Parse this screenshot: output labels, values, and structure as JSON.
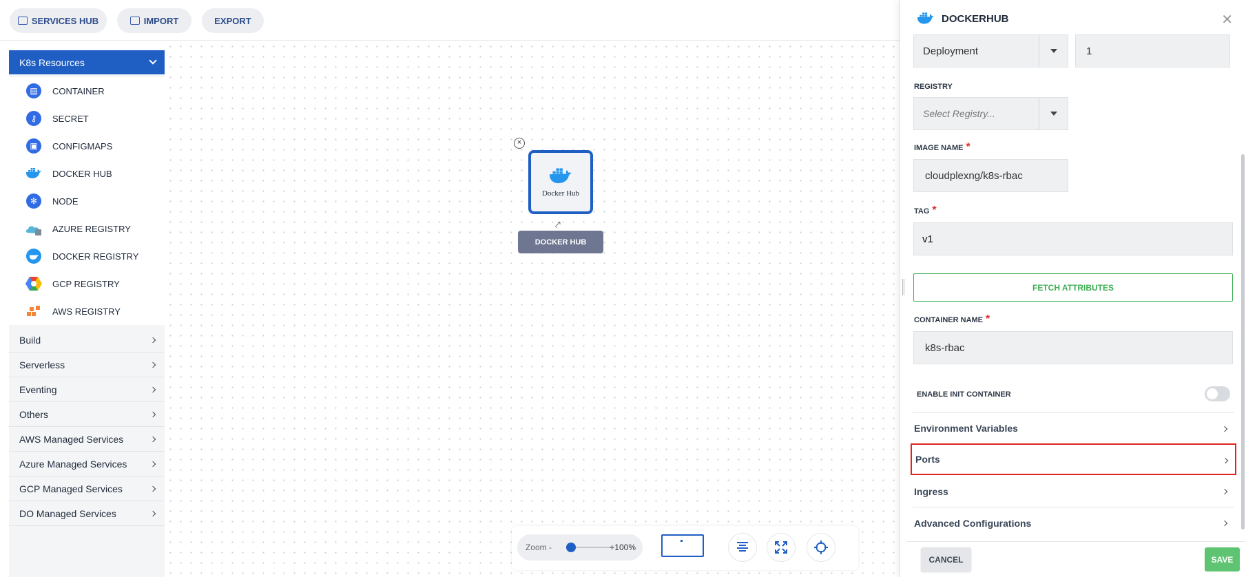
{
  "toolbar": {
    "services_hub": "SERVICES HUB",
    "import": "IMPORT",
    "export": "EXPORT"
  },
  "sidebar": {
    "k8s_header": "K8s Resources",
    "resources": [
      {
        "label": "CONTAINER",
        "icon": "container-icon"
      },
      {
        "label": "SECRET",
        "icon": "secret-icon"
      },
      {
        "label": "CONFIGMAPS",
        "icon": "configmaps-icon"
      },
      {
        "label": "DOCKER HUB",
        "icon": "docker-whale-icon"
      },
      {
        "label": "NODE",
        "icon": "node-icon"
      },
      {
        "label": "AZURE REGISTRY",
        "icon": "azure-registry-icon"
      },
      {
        "label": "DOCKER REGISTRY",
        "icon": "docker-registry-icon"
      },
      {
        "label": "GCP REGISTRY",
        "icon": "gcp-registry-icon"
      },
      {
        "label": "AWS REGISTRY",
        "icon": "aws-registry-icon"
      }
    ],
    "categories": [
      "Build",
      "Serverless",
      "Eventing",
      "Others",
      "AWS Managed Services",
      "Azure Managed Services",
      "GCP Managed Services",
      "DO Managed Services"
    ]
  },
  "canvas": {
    "node_label": "Docker Hub",
    "node_tag": "DOCKER HUB",
    "close_glyph": "×",
    "link_glyph": "⤤"
  },
  "zoom": {
    "label": "Zoom -",
    "value": "+100%",
    "level": 1.0
  },
  "panel": {
    "title": "DOCKERHUB",
    "close_glyph": "✕",
    "kind_select": "Deployment",
    "replicas": "1",
    "registry_label": "REGISTRY",
    "registry_placeholder": "Select Registry...",
    "image_name_label": "IMAGE NAME",
    "image_name_value": "cloudplexng/k8s-rbac",
    "tag_label": "TAG",
    "tag_value": "v1",
    "required_marker": "*",
    "fetch_button": "FETCH ATTRIBUTES",
    "container_name_label": "CONTAINER NAME",
    "container_name_value": "k8s-rbac",
    "init_container_label": "ENABLE INIT CONTAINER",
    "init_container_enabled": false,
    "sections": [
      "Environment Variables",
      "Ports",
      "Ingress",
      "Advanced Configurations"
    ],
    "highlighted_section": "Ports",
    "cancel_button": "CANCEL",
    "save_button": "SAVE"
  },
  "colors": {
    "primary": "#1f5fc4",
    "success": "#3cae55",
    "highlight": "#e02424",
    "node_tag": "#6f7692"
  }
}
